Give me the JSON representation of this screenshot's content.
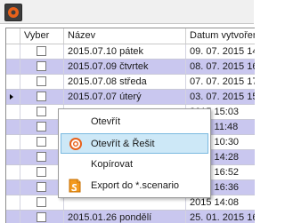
{
  "columns": {
    "select": "Vyber",
    "name": "Název",
    "date": "Datum vytvoření"
  },
  "rows": [
    {
      "name": "2015.07.10 pátek",
      "date": "09. 07. 2015 14:4",
      "alt": false
    },
    {
      "name": "2015.07.09 čtvrtek",
      "date": "08. 07. 2015 16:25",
      "alt": true
    },
    {
      "name": "2015.07.08 středa",
      "date": "07. 07. 2015 17:17",
      "alt": false
    },
    {
      "name": "2015.07.07 úterý",
      "date": "03. 07. 2015 15:13",
      "alt": true,
      "current": true
    },
    {
      "name": "",
      "date": "2015 15:03",
      "alt": false
    },
    {
      "name": "",
      "date": "2015 11:48",
      "alt": true
    },
    {
      "name": "",
      "date": "2015 10:30",
      "alt": false
    },
    {
      "name": "",
      "date": "2015 14:28",
      "alt": true
    },
    {
      "name": "",
      "date": "2015 16:52",
      "alt": false
    },
    {
      "name": "",
      "date": "2015 16:36",
      "alt": true
    },
    {
      "name": "",
      "date": "2015 14:08",
      "alt": false
    },
    {
      "name": "2015.01.26 pondělí",
      "date": "25. 01. 2015 16:47",
      "alt": true
    }
  ],
  "context_menu": {
    "items": [
      {
        "label": "Otevřít",
        "icon": "none"
      },
      {
        "label": "Otevřít & Řešit",
        "icon": "gear-icon"
      },
      {
        "label": "Kopírovat",
        "icon": "none"
      },
      {
        "label": "Export do *.scenario",
        "icon": "scenario-file-icon"
      }
    ]
  },
  "colors": {
    "alt_row": "#c9c7ef",
    "menu_hover": "#cde8f7",
    "accent": "#e8611a"
  }
}
